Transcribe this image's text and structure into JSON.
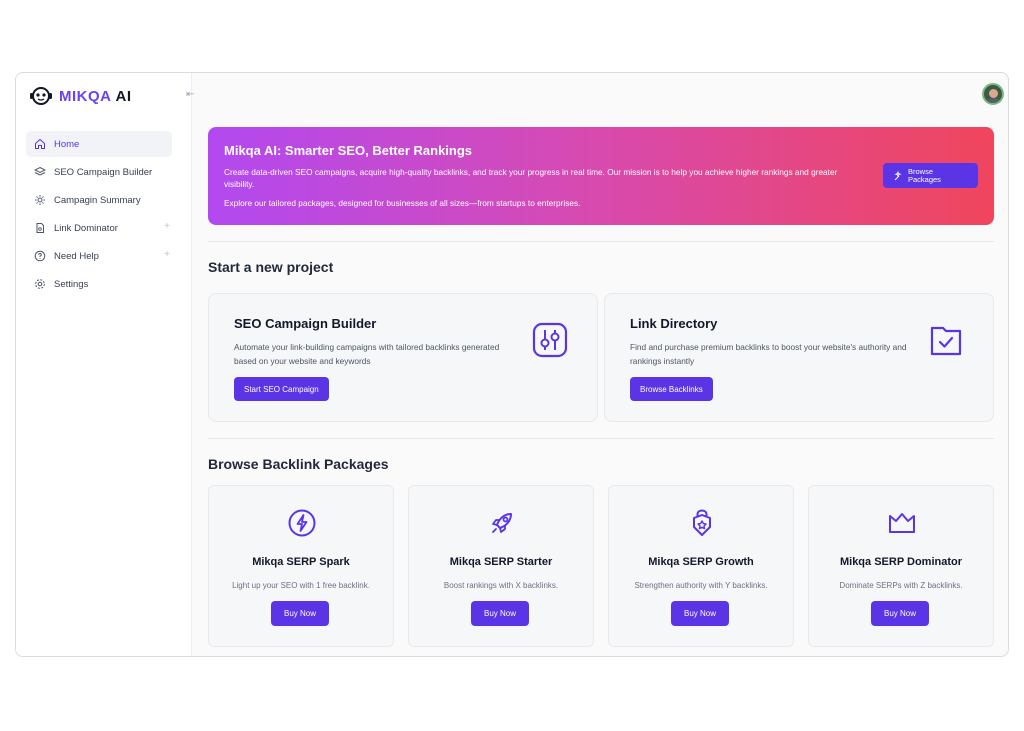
{
  "app": {
    "brand": "MIKQA",
    "suffix": "AI",
    "accent": "#5b34e6"
  },
  "sidebar": {
    "items": [
      {
        "label": "Home",
        "icon": "home-icon",
        "active": true
      },
      {
        "label": "SEO Campaign Builder",
        "icon": "layers-icon"
      },
      {
        "label": "Campagin Summary",
        "icon": "settings-gear-icon"
      },
      {
        "label": "Link Dominator",
        "icon": "document-icon",
        "expandable": true
      },
      {
        "label": "Need Help",
        "icon": "help-icon",
        "expandable": true
      },
      {
        "label": "Settings",
        "icon": "gear-icon"
      }
    ]
  },
  "hero": {
    "title": "Mikqa AI: Smarter SEO, Better Rankings",
    "text1": "Create data-driven SEO campaigns, acquire high-quality backlinks, and track your progress in real time. Our mission is to help you achieve higher rankings and greater visibility.",
    "text2": "Explore our tailored packages, designed for businesses of all sizes—from startups to enterprises.",
    "button_line1": "Browse",
    "button_line2": "Packages"
  },
  "projects": {
    "title": "Start a new project",
    "cards": [
      {
        "title": "SEO Campaign Builder",
        "desc": "Automate your link-building campaigns with tailored backlinks generated based on your website and keywords",
        "button": "Start SEO Campaign",
        "icon": "sliders-icon"
      },
      {
        "title": "Link Directory",
        "desc": "Find and purchase premium backlinks to boost your website's authority and rankings instantly",
        "button": "Browse Backlinks",
        "icon": "folder-check-icon"
      }
    ]
  },
  "packages": {
    "title": "Browse Backlink Packages",
    "items": [
      {
        "name": "Mikqa SERP Spark",
        "desc": "Light up your SEO with 1 free backlink.",
        "button": "Buy Now",
        "icon": "bolt-icon"
      },
      {
        "name": "Mikqa SERP Starter",
        "desc": "Boost rankings with X backlinks.",
        "button": "Buy Now",
        "icon": "rocket-icon"
      },
      {
        "name": "Mikqa SERP Growth",
        "desc": "Strengthen authority with Y backlinks.",
        "button": "Buy Now",
        "icon": "lock-badge-icon"
      },
      {
        "name": "Mikqa SERP Dominator",
        "desc": "Dominate SERPs with Z backlinks.",
        "button": "Buy Now",
        "icon": "crown-icon"
      }
    ]
  }
}
